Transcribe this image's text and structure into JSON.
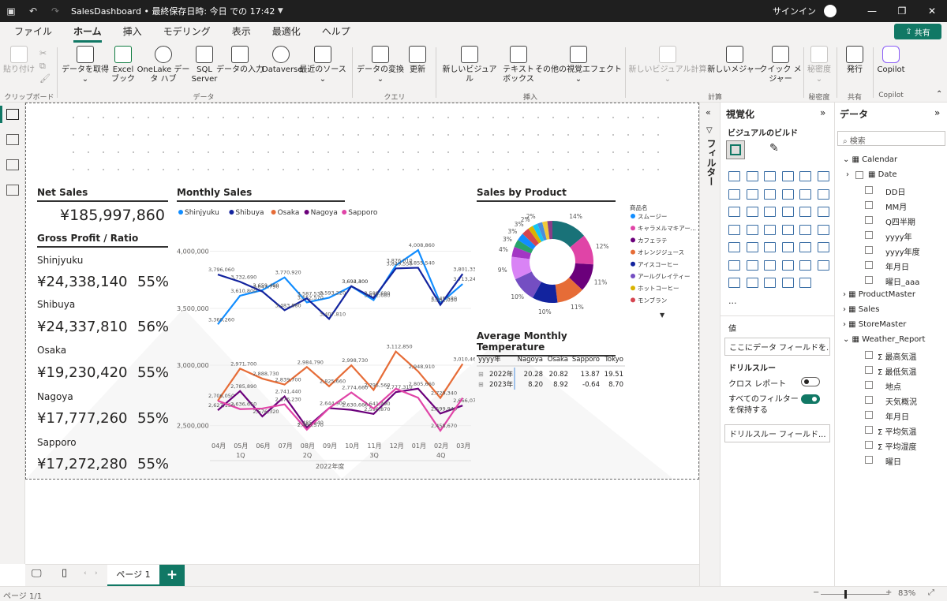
{
  "titlebar": {
    "title": "SalesDashboard • 最終保存日時: 今日 での 17:42",
    "signin": "サインイン"
  },
  "ribbon_tabs": [
    "ファイル",
    "ホーム",
    "挿入",
    "モデリング",
    "表示",
    "最適化",
    "ヘルプ"
  ],
  "share_label": "共有",
  "ribbon": {
    "paste": "貼り付け",
    "get_data": "データを取得",
    "excel": "Excel ブック",
    "onelake": "OneLake データ ハブ",
    "sql": "SQL Server",
    "enter_data": "データの入力",
    "dataverse": "Dataverse",
    "recent": "最近のソース",
    "transform": "データの変換",
    "refresh": "更新",
    "new_visual": "新しいビジュアル",
    "textbox": "テキスト ボックス",
    "more_visuals": "その他の視覚エフェクト",
    "new_calc": "新しいビジュアル計算",
    "new_measure": "新しいメジャー",
    "quick_measure": "クイック メジャー",
    "sensitivity": "秘密度",
    "publish": "発行",
    "copilot": "Copilot",
    "groups": {
      "clipboard": "クリップボード",
      "data": "データ",
      "query": "クエリ",
      "insert": "挿入",
      "calc": "計算",
      "sensitivity": "秘密度",
      "share": "共有",
      "copilot": "Copilot"
    }
  },
  "kpi": {
    "net_sales_title": "Net Sales",
    "net_sales_value": "¥185,997,860",
    "gross_title": "Gross Profit /  Ratio",
    "rows": [
      {
        "city": "Shinjyuku",
        "amount": "¥24,338,140",
        "ratio": "55%"
      },
      {
        "city": "Shibuya",
        "amount": "¥24,337,810",
        "ratio": "56%"
      },
      {
        "city": "Osaka",
        "amount": "¥19,230,420",
        "ratio": "55%"
      },
      {
        "city": "Nagoya",
        "amount": "¥17,777,260",
        "ratio": "55%"
      },
      {
        "city": "Sapporo",
        "amount": "¥17,272,280",
        "ratio": "55%"
      }
    ]
  },
  "chart_data": [
    {
      "type": "line",
      "title": "Monthly Sales",
      "xlabel": "2022年度",
      "categories": [
        "04月",
        "05月",
        "06月",
        "07月",
        "08月",
        "09月",
        "10月",
        "11月",
        "12月",
        "01月",
        "02月",
        "03月"
      ],
      "quarters": [
        "1Q",
        "2Q",
        "3Q",
        "4Q"
      ],
      "yticks_upper": [
        "4,000,000",
        "3,500,000"
      ],
      "yticks_lower": [
        "3,000,000",
        "2,500,000"
      ],
      "upper_range": [
        3300000,
        4100000
      ],
      "lower_range": [
        2400000,
        3150000
      ],
      "series": [
        {
          "name": "Shinjyuku",
          "color": "#118dff",
          "panel": "upper",
          "values": [
            3360260,
            3610800,
            3659490,
            3770920,
            3552570,
            3593220,
            3692300,
            3572680,
            3876010,
            4008860,
            3545580,
            3713240
          ],
          "labels": [
            "3,360,260",
            "3,610,800",
            "3,659,490",
            "3,770,920",
            "3,552,570",
            "3,593,220",
            "3,692,300",
            "3,572,680",
            "3,876,010",
            "4,008,860",
            "3,545,580",
            "3,713,240"
          ]
        },
        {
          "name": "Shibuya",
          "color": "#12239e",
          "panel": "upper",
          "values": [
            3796060,
            3732690,
            3647790,
            3483880,
            3587530,
            3407810,
            3694400,
            3589680,
            3849550,
            3855540,
            3531030,
            3801330
          ],
          "labels": [
            "3,796,060",
            "3,732,690",
            "3,647,790",
            "3,483,880",
            "3,587,530",
            "3,407,810",
            "3,694,400",
            "3,589,680",
            "3,849,550",
            "3,855,540",
            "3,531,030",
            "3,801,330"
          ]
        },
        {
          "name": "Osaka",
          "color": "#e66c37",
          "panel": "lower",
          "values": [
            2706050,
            2971700,
            2888730,
            2839700,
            2984790,
            2825660,
            2998730,
            2795560,
            3112850,
            2948910,
            2729340,
            3010460
          ],
          "labels": [
            "2,706,050",
            "2,971,700",
            "2,888,730",
            "2,839,700",
            "2,984,790",
            "2,825,660",
            "2,998,730",
            "2,795,560",
            "3,112,850",
            "2,948,910",
            "2,729,340",
            "3,010,460"
          ]
        },
        {
          "name": "Nagoya",
          "color": "#6b007b",
          "panel": "lower",
          "values": [
            2627150,
            2785890,
            2576320,
            2741440,
            2485640,
            2644900,
            2630660,
            2596870,
            2777310,
            2805660,
            2599940,
            2666070
          ],
          "labels": [
            "2,627,150",
            "2,785,890",
            "2,576,320",
            "2,741,440",
            "2,485,640",
            "2,644,900",
            "2,630,660",
            "2,596,870",
            "2,777,310",
            "2,805,660",
            "2,599,940",
            "2,666,070"
          ]
        },
        {
          "name": "Sapporo",
          "color": "#e044a7",
          "panel": "lower",
          "values": [
            2706050,
            2636650,
            2641640,
            2676230,
            2466570,
            2644900,
            2774660,
            2641490,
            2805660,
            2730850,
            2458670,
            2729340
          ],
          "labels": [
            "",
            "2,636,650",
            "",
            "2,676,230",
            "2,466,570",
            "",
            "2,774,660",
            "2,641,490",
            "",
            "",
            "2,458,670",
            ""
          ]
        }
      ]
    },
    {
      "type": "pie",
      "title": "Sales by Product",
      "legend_title": "商品名",
      "legend": [
        {
          "name": "スムージー",
          "color": "#118dff"
        },
        {
          "name": "キャラメルマキアー...",
          "color": "#e044a7"
        },
        {
          "name": "カフェラテ",
          "color": "#6b007b"
        },
        {
          "name": "オレンジジュース",
          "color": "#e66c37"
        },
        {
          "name": "アイスコーヒー",
          "color": "#12239e"
        },
        {
          "name": "アールグレイティー",
          "color": "#744ec2"
        },
        {
          "name": "ホットコーヒー",
          "color": "#d9b300"
        },
        {
          "name": "モンブラン",
          "color": "#d64550"
        }
      ],
      "slices": [
        {
          "value": 14,
          "label": "14%",
          "color": "#197278"
        },
        {
          "value": 12,
          "label": "12%",
          "color": "#e044a7"
        },
        {
          "value": 11,
          "label": "11%",
          "color": "#6b007b"
        },
        {
          "value": 11,
          "label": "11%",
          "color": "#e66c37"
        },
        {
          "value": 10,
          "label": "10%",
          "color": "#12239e"
        },
        {
          "value": 10,
          "label": "10%",
          "color": "#744ec2"
        },
        {
          "value": 9,
          "label": "9%",
          "color": "#d983f5"
        },
        {
          "value": 4,
          "label": "4%",
          "color": "#a336c4"
        },
        {
          "value": 3,
          "label": "3%",
          "color": "#29a36a"
        },
        {
          "value": 3,
          "label": "3%",
          "color": "#118dff"
        },
        {
          "value": 3,
          "label": "3%",
          "color": "#d64550"
        },
        {
          "value": 2,
          "label": "2%",
          "color": "#d9b300"
        },
        {
          "value": 2,
          "label": "2%",
          "color": "#15c6f4"
        },
        {
          "value": 2,
          "label": "",
          "color": "#4a8ddc"
        },
        {
          "value": 2,
          "label": "",
          "color": "#f0c93a"
        },
        {
          "value": 2,
          "label": "",
          "color": "#8b3d88"
        }
      ]
    },
    {
      "type": "table",
      "title": "Average Monthly Temperature",
      "columns": [
        "yyyy年",
        "Nagoya",
        "Osaka",
        "Sapporo",
        "Tokyo"
      ],
      "rows": [
        [
          "2022年",
          "20.28",
          "20.82",
          "13.87",
          "19.51"
        ],
        [
          "2023年",
          "8.20",
          "8.92",
          "-0.64",
          "8.70"
        ]
      ]
    }
  ],
  "pages": {
    "tab": "ページ 1",
    "status": "ページ 1/1",
    "zoom": "83%"
  },
  "filters_label": "フィルター",
  "viz_pane": {
    "title": "視覚化",
    "build": "ビジュアルのビルド",
    "values": "値",
    "values_placeholder": "ここにデータ フィールドを...",
    "drill_title": "ドリルスルー",
    "cross_report": "クロス レポート",
    "keep_filters": "すべてのフィルター を保持する",
    "drill_placeholder": "ドリルスルー フィールド..."
  },
  "data_pane": {
    "title": "データ",
    "search_placeholder": "検索",
    "tables": [
      {
        "name": "Calendar",
        "expanded": true,
        "fields": [
          {
            "name": "Date",
            "type": "table",
            "level": 1
          },
          {
            "name": "DD日",
            "type": "field",
            "level": 2
          },
          {
            "name": "MM月",
            "type": "field",
            "level": 2
          },
          {
            "name": "Q四半期",
            "type": "field",
            "level": 2
          },
          {
            "name": "yyyy年",
            "type": "field",
            "level": 2
          },
          {
            "name": "yyyy年度",
            "type": "field",
            "level": 2
          },
          {
            "name": "年月日",
            "type": "field",
            "level": 2
          },
          {
            "name": "曜日_aaa",
            "type": "field",
            "level": 2
          }
        ]
      },
      {
        "name": "ProductMaster",
        "expanded": false,
        "fields": []
      },
      {
        "name": "Sales",
        "expanded": false,
        "fields": []
      },
      {
        "name": "StoreMaster",
        "expanded": false,
        "fields": []
      },
      {
        "name": "Weather_Report",
        "expanded": true,
        "fields": [
          {
            "name": "最高気温",
            "type": "sum",
            "level": 1
          },
          {
            "name": "最低気温",
            "type": "sum",
            "level": 1
          },
          {
            "name": "地点",
            "type": "field",
            "level": 1
          },
          {
            "name": "天気概況",
            "type": "field",
            "level": 1
          },
          {
            "name": "年月日",
            "type": "field",
            "level": 1
          },
          {
            "name": "平均気温",
            "type": "sum",
            "level": 1
          },
          {
            "name": "平均湿度",
            "type": "sum",
            "level": 1
          },
          {
            "name": "曜日",
            "type": "field",
            "level": 1
          }
        ]
      }
    ]
  }
}
